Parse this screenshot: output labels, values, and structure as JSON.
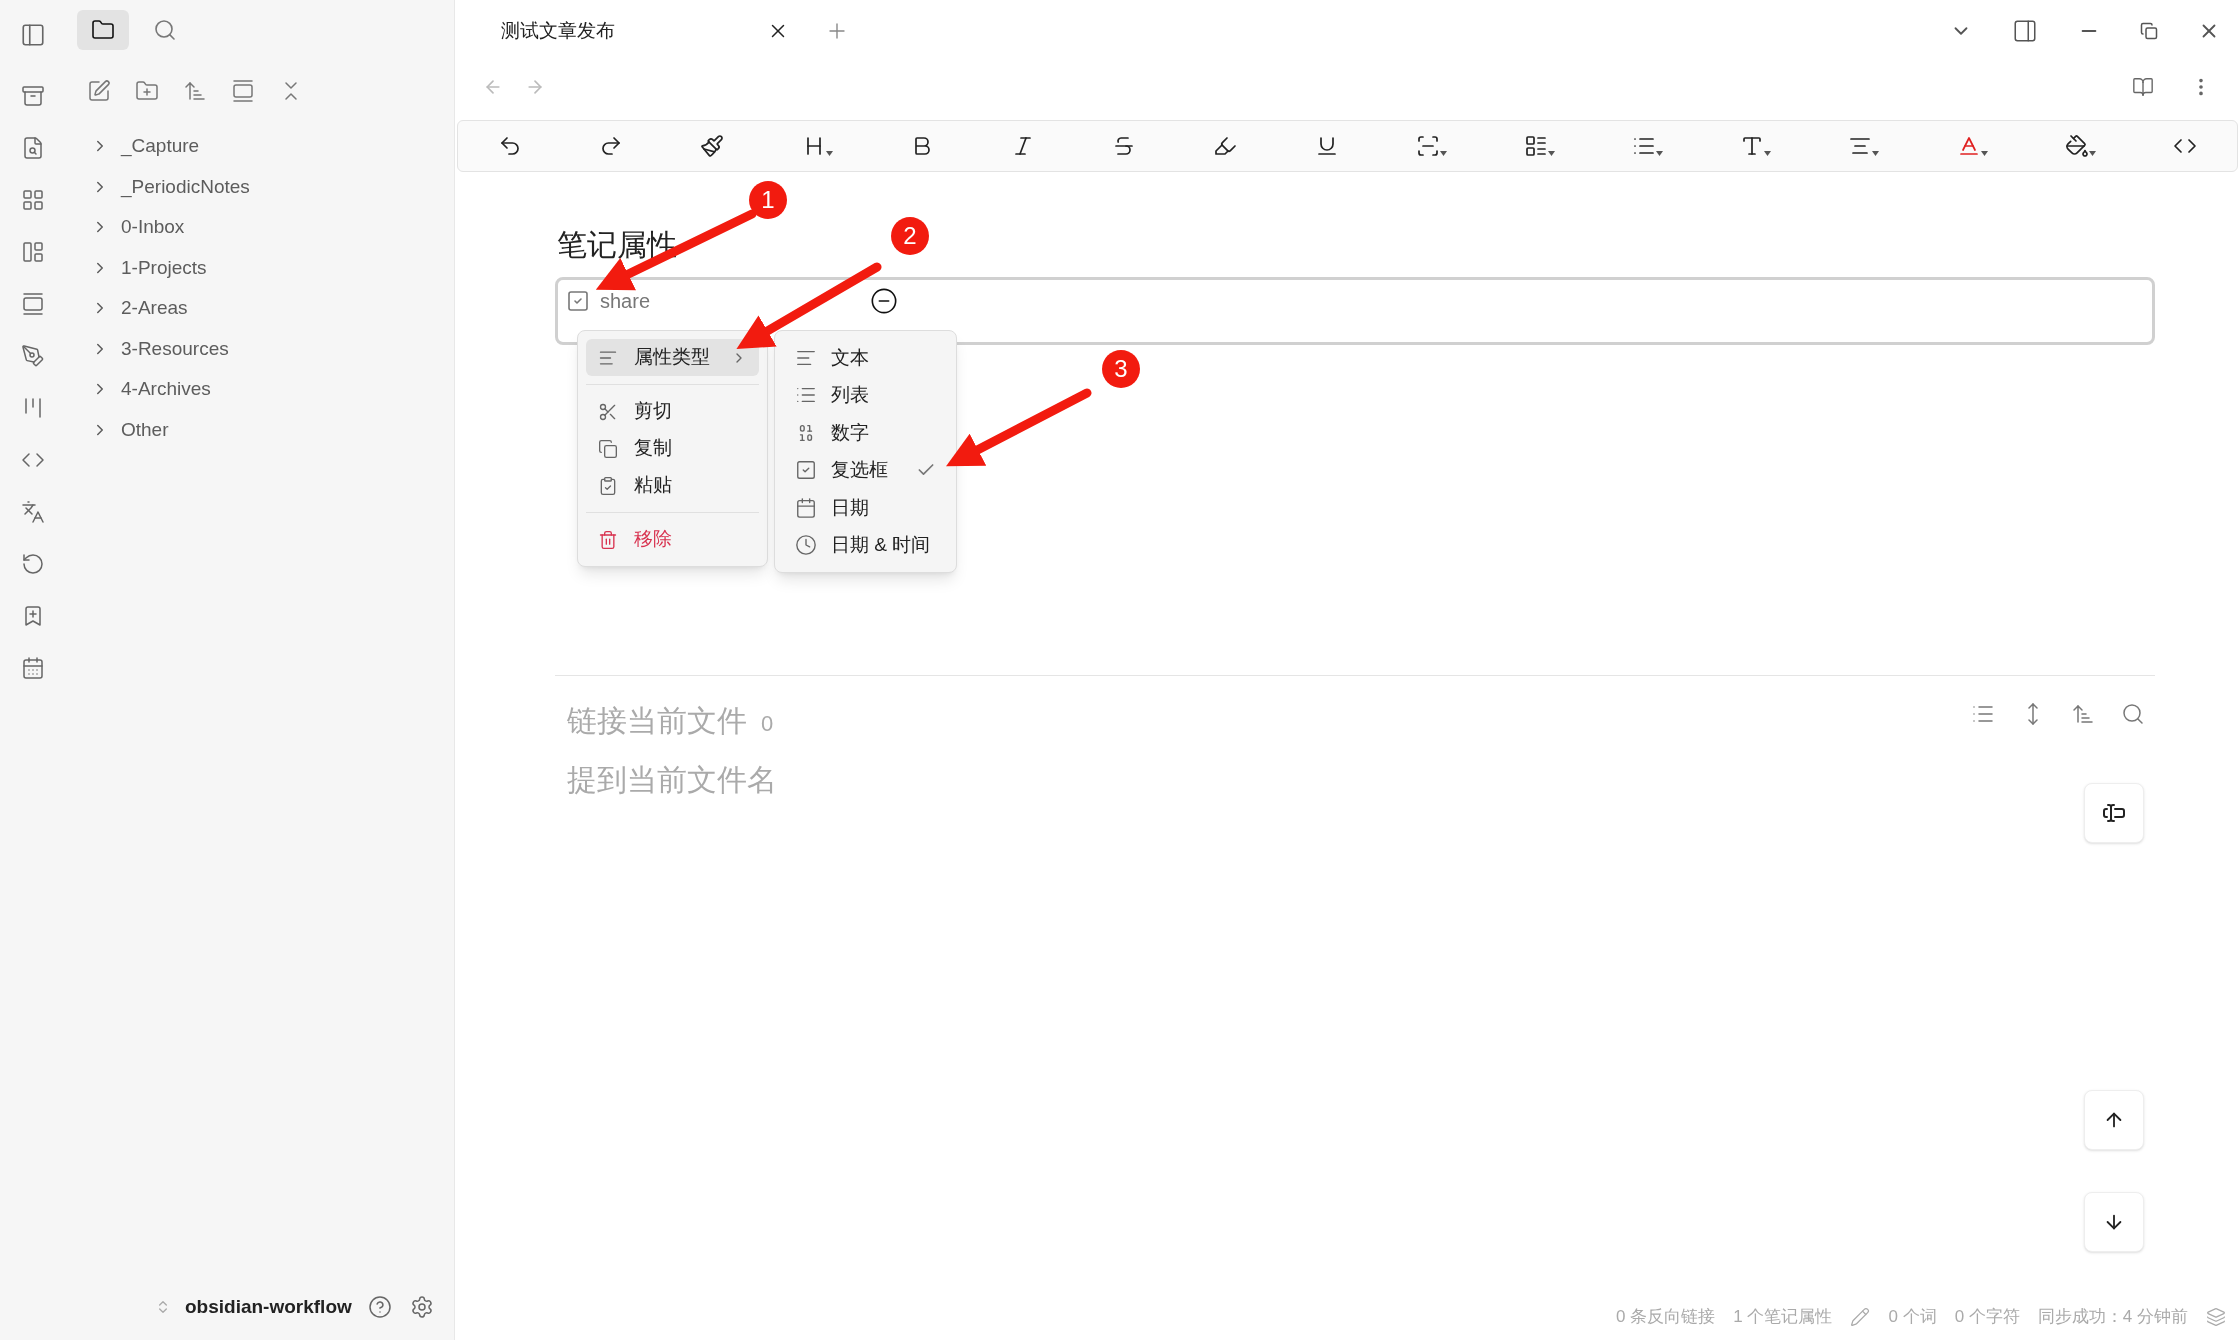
{
  "sidebar_tabs": [
    {
      "kind": "files",
      "selected": true
    },
    {
      "kind": "search",
      "selected": false
    }
  ],
  "file_tree": [
    {
      "label": "_Capture",
      "expanded": false
    },
    {
      "label": "_PeriodicNotes",
      "expanded": false
    },
    {
      "label": "0-Inbox",
      "expanded": false
    },
    {
      "label": "1-Projects",
      "expanded": false
    },
    {
      "label": "2-Areas",
      "expanded": false
    },
    {
      "label": "3-Resources",
      "expanded": false
    },
    {
      "label": "4-Archives",
      "expanded": false
    },
    {
      "label": "Other",
      "expanded": false
    }
  ],
  "vault": {
    "name": "obsidian-workflow"
  },
  "tabs": [
    {
      "title": "测试文章发布",
      "selected": true
    }
  ],
  "toolbar": [
    {
      "kind": "undo",
      "dropdown": false
    },
    {
      "kind": "redo",
      "dropdown": false
    },
    {
      "kind": "brush",
      "dropdown": false
    },
    {
      "kind": "heading",
      "dropdown": true
    },
    {
      "kind": "bold",
      "dropdown": false
    },
    {
      "kind": "italic",
      "dropdown": false
    },
    {
      "kind": "strike",
      "dropdown": false
    },
    {
      "kind": "highlight",
      "dropdown": false
    },
    {
      "kind": "underline",
      "dropdown": false
    },
    {
      "kind": "scan",
      "dropdown": true
    },
    {
      "kind": "layout",
      "dropdown": true
    },
    {
      "kind": "list",
      "dropdown": true
    },
    {
      "kind": "type",
      "dropdown": true
    },
    {
      "kind": "align",
      "dropdown": true
    },
    {
      "kind": "color",
      "dropdown": true
    },
    {
      "kind": "fill",
      "dropdown": true
    },
    {
      "kind": "code",
      "dropdown": false
    }
  ],
  "properties": {
    "heading": "笔记属性",
    "items": [
      {
        "name": "share",
        "kind": "checkbox"
      }
    ]
  },
  "context_menu": {
    "groups": [
      [
        {
          "label": "属性类型",
          "kind": "submenu",
          "highlighted": true
        }
      ],
      [
        {
          "label": "剪切",
          "kind": "cut",
          "highlighted": false
        },
        {
          "label": "复制",
          "kind": "copy",
          "highlighted": false
        },
        {
          "label": "粘贴",
          "kind": "paste",
          "highlighted": false
        }
      ],
      [
        {
          "label": "移除",
          "kind": "remove",
          "highlighted": false
        }
      ]
    ]
  },
  "type_menu": [
    {
      "label": "文本",
      "kind": "text",
      "selected": false
    },
    {
      "label": "列表",
      "kind": "list",
      "selected": false
    },
    {
      "label": "数字",
      "kind": "number",
      "selected": false
    },
    {
      "label": "复选框",
      "kind": "checkbox",
      "selected": true
    },
    {
      "label": "日期",
      "kind": "date",
      "selected": false
    },
    {
      "label": "日期 & 时间",
      "kind": "datetime",
      "selected": false
    }
  ],
  "backlinks": {
    "linked_title": "链接当前文件",
    "linked_count": "0",
    "unlinked_title": "提到当前文件名"
  },
  "status_bar": {
    "backlinks": "0 条反向链接",
    "properties": "1 个笔记属性",
    "words": "0 个词",
    "chars": "0 个字符",
    "sync": "同步成功：4 分钟前"
  },
  "annotations": [
    {
      "label": "1"
    },
    {
      "label": "2"
    },
    {
      "label": "3"
    }
  ]
}
